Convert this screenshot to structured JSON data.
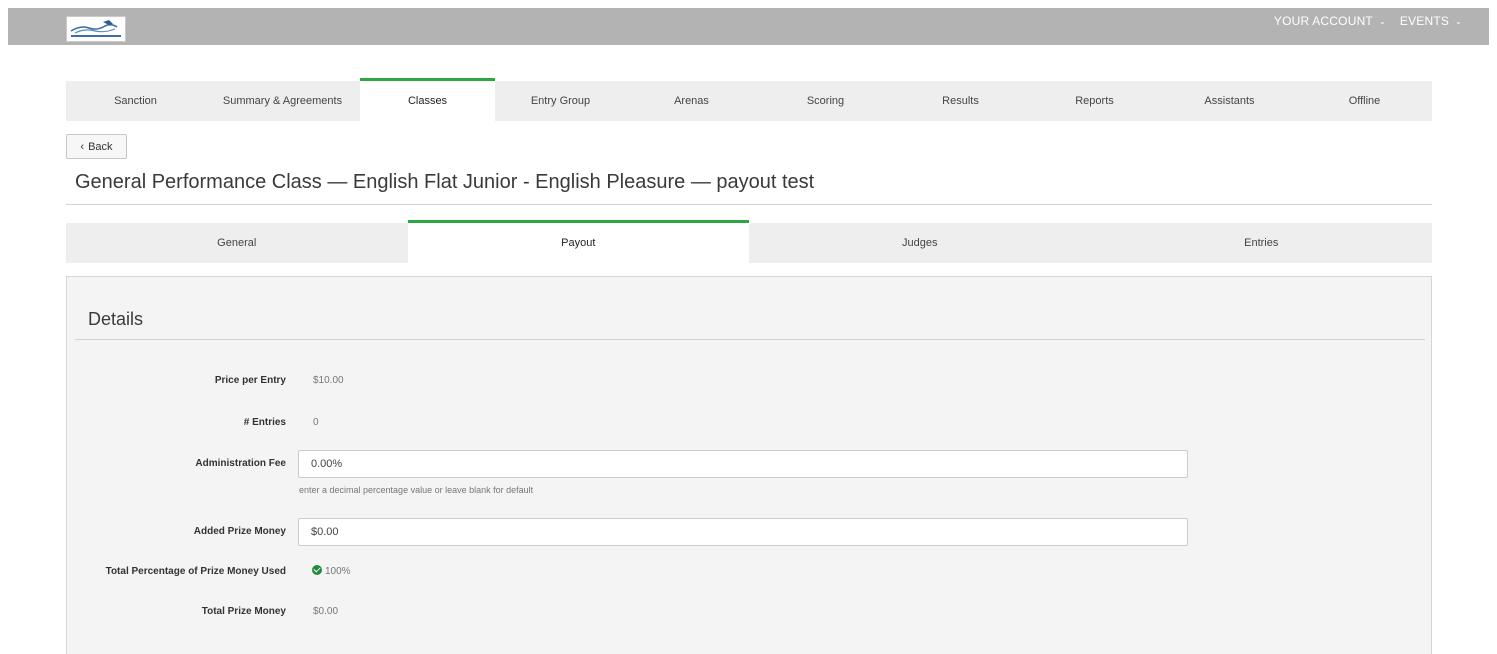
{
  "header": {
    "logo_name": "nova-scotia-equestrian-logo",
    "nav": [
      {
        "label": "YOUR ACCOUNT",
        "caret": "⌄"
      },
      {
        "label": "EVENTS",
        "caret": "⌄"
      }
    ]
  },
  "main_tabs": [
    {
      "label": "Sanction",
      "active": false
    },
    {
      "label": "Summary & Agreements",
      "active": false
    },
    {
      "label": "Classes",
      "active": true
    },
    {
      "label": "Entry Group",
      "active": false
    },
    {
      "label": "Arenas",
      "active": false
    },
    {
      "label": "Scoring",
      "active": false
    },
    {
      "label": "Results",
      "active": false
    },
    {
      "label": "Reports",
      "active": false
    },
    {
      "label": "Assistants",
      "active": false
    },
    {
      "label": "Offline",
      "active": false
    }
  ],
  "back_button": {
    "label": "Back"
  },
  "page_title": "General Performance Class — English Flat Junior - English Pleasure — payout test",
  "sub_tabs": [
    {
      "label": "General",
      "active": false
    },
    {
      "label": "Payout",
      "active": true
    },
    {
      "label": "Judges",
      "active": false
    },
    {
      "label": "Entries",
      "active": false
    }
  ],
  "details": {
    "title": "Details",
    "price_per_entry": {
      "label": "Price per Entry",
      "value": "$10.00"
    },
    "entries": {
      "label": "# Entries",
      "value": "0"
    },
    "admin_fee": {
      "label": "Administration Fee",
      "value": "0.00%",
      "help": "enter a decimal percentage value or leave blank for default"
    },
    "added_prize": {
      "label": "Added Prize Money",
      "value": "$0.00"
    },
    "total_percentage": {
      "label": "Total Percentage of Prize Money Used",
      "value": "100%"
    },
    "total_prize": {
      "label": "Total Prize Money",
      "value": "$0.00"
    }
  },
  "colors": {
    "accent": "#2ca843",
    "topbar": "#b3b3b3",
    "ok": "#1f8a3a"
  }
}
